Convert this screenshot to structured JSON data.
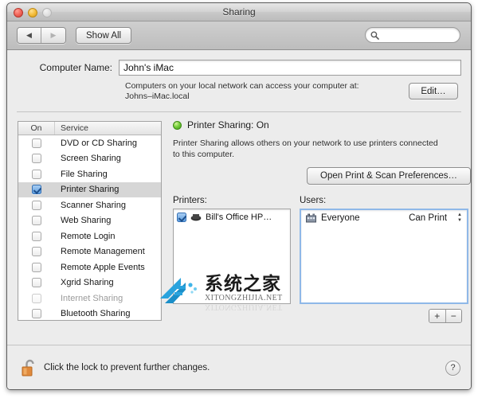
{
  "window": {
    "title": "Sharing",
    "traffic_lights": [
      "close-button",
      "minimize-button",
      "zoom-button"
    ]
  },
  "toolbar": {
    "back_label": "◀",
    "forward_label": "▶",
    "show_all_label": "Show All",
    "search_value": "",
    "search_placeholder": ""
  },
  "computer_name": {
    "label": "Computer Name:",
    "value": "John's iMac",
    "hint_line1": "Computers on your local network can access your computer at:",
    "hint_line2": "Johns–iMac.local",
    "edit_label": "Edit…"
  },
  "service_list": {
    "header": {
      "on": "On",
      "service": "Service"
    },
    "items": [
      {
        "name": "DVD or CD Sharing",
        "checked": false,
        "selected": false,
        "disabled": false
      },
      {
        "name": "Screen Sharing",
        "checked": false,
        "selected": false,
        "disabled": false
      },
      {
        "name": "File Sharing",
        "checked": false,
        "selected": false,
        "disabled": false
      },
      {
        "name": "Printer Sharing",
        "checked": true,
        "selected": true,
        "disabled": false
      },
      {
        "name": "Scanner Sharing",
        "checked": false,
        "selected": false,
        "disabled": false
      },
      {
        "name": "Web Sharing",
        "checked": false,
        "selected": false,
        "disabled": false
      },
      {
        "name": "Remote Login",
        "checked": false,
        "selected": false,
        "disabled": false
      },
      {
        "name": "Remote Management",
        "checked": false,
        "selected": false,
        "disabled": false
      },
      {
        "name": "Remote Apple Events",
        "checked": false,
        "selected": false,
        "disabled": false
      },
      {
        "name": "Xgrid Sharing",
        "checked": false,
        "selected": false,
        "disabled": false
      },
      {
        "name": "Internet Sharing",
        "checked": false,
        "selected": false,
        "disabled": true
      },
      {
        "name": "Bluetooth Sharing",
        "checked": false,
        "selected": false,
        "disabled": false
      }
    ]
  },
  "detail": {
    "status_text": "Printer Sharing: On",
    "status_color": "#6cc22f",
    "description": "Printer Sharing allows others on your network to use printers connected to this computer.",
    "open_prefs_label": "Open Print & Scan Preferences…",
    "printers": {
      "label": "Printers:",
      "items": [
        {
          "name": "Bill's Office HP…",
          "checked": true
        }
      ]
    },
    "users": {
      "label": "Users:",
      "items": [
        {
          "name": "Everyone",
          "permission": "Can Print"
        }
      ]
    },
    "add_label": "+",
    "remove_label": "−"
  },
  "footer": {
    "lock_text": "Click the lock to prevent further changes.",
    "lock_state": "unlocked",
    "help_label": "?"
  },
  "watermark": {
    "chinese": "系统之家",
    "english": "XITONGZHIJIA.NET",
    "logo_color": "#1b9ad6"
  }
}
